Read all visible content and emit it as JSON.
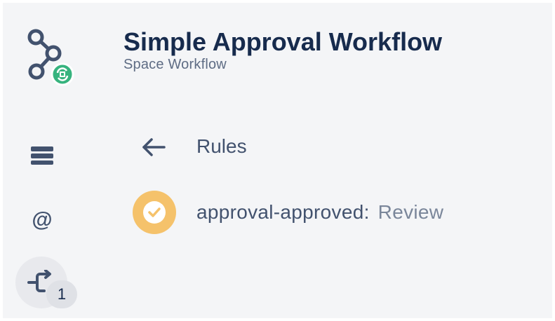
{
  "header": {
    "title": "Simple Approval Workflow",
    "subtitle": "Space Workflow",
    "logo_icon": "workflow-nodes-icon",
    "logo_badge_icon": "space-badge-icon"
  },
  "sidebar": {
    "items": [
      {
        "name": "list",
        "icon": "list-icon"
      },
      {
        "name": "mentions",
        "icon": "at-icon",
        "glyph": "@"
      },
      {
        "name": "rules",
        "icon": "rules-branch-icon",
        "badge": "1"
      }
    ]
  },
  "rules_view": {
    "back_icon": "arrow-left-icon",
    "heading": "Rules",
    "rules": [
      {
        "name": "approval-approved:",
        "state": "Review",
        "status_icon": "check-icon"
      }
    ]
  },
  "colors": {
    "panel_bg": "#f4f5f7",
    "title": "#172b4d",
    "text": "#42526e",
    "muted": "#7a869a",
    "status_pending": "#f5c26b",
    "badge_green": "#36b37e"
  }
}
